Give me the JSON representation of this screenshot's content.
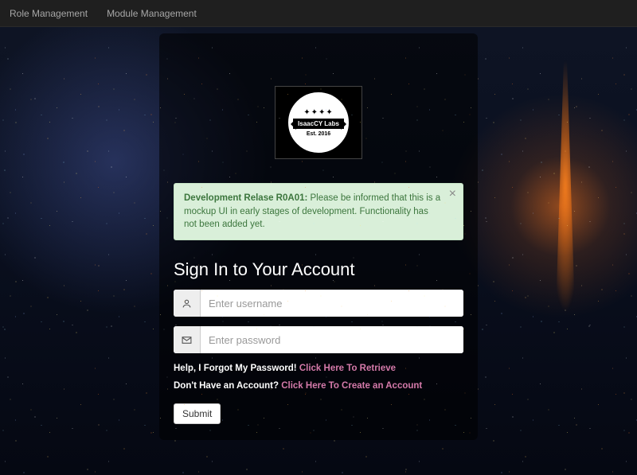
{
  "nav": {
    "items": [
      "Role Management",
      "Module Management"
    ]
  },
  "logo": {
    "name": "IsaacCY Labs",
    "est": "Est. 2016"
  },
  "alert": {
    "strong": "Development Relase R0A01:",
    "text": " Please be informed that this is a mockup UI in early stages of development. Functionality has not been added yet."
  },
  "heading": "Sign In to Your Account",
  "username": {
    "placeholder": "Enter username"
  },
  "password": {
    "placeholder": "Enter password"
  },
  "forgot": {
    "prefix": "Help, I Forgot My Password! ",
    "link": "Click Here To Retrieve"
  },
  "signup": {
    "prefix": "Don't Have an Account? ",
    "link": "Click Here To Create an Account"
  },
  "submit_label": "Submit"
}
